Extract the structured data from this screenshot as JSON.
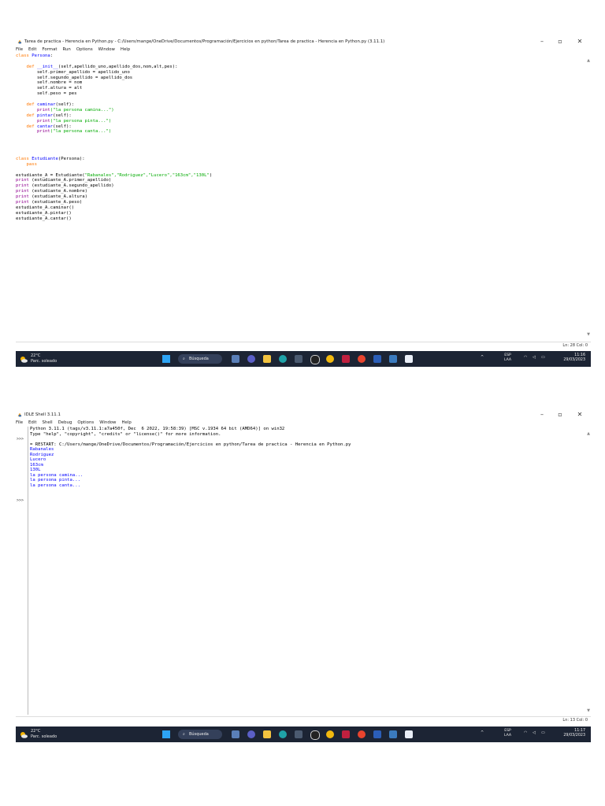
{
  "editor_window": {
    "title": "Tarea de practica - Herencia en Python.py - C:/Users/mange/OneDrive/Documentos/Programación/Ejercicios en python/Tarea de practica - Herencia en Python.py (3.11.1)",
    "menu": [
      "File",
      "Edit",
      "Format",
      "Run",
      "Options",
      "Window",
      "Help"
    ],
    "controls": {
      "minimize": "–",
      "maximize": "▫",
      "close": "✕"
    },
    "status": "Ln: 28   Col: 0"
  },
  "code": {
    "l1_kw": "class ",
    "l1_name": "Persona",
    "l1_rest": ":",
    "l3_kw": "    def ",
    "l3_name": "__init__",
    "l3_rest": "(self,apellido_uno,apellido_dos,nom,alt,pes):",
    "l4": "        self.primer_apellido = apellido_uno",
    "l5": "        self.segundo_apellido = apellido_dos",
    "l6": "        self.nombre = nom",
    "l7": "        self.altura = alt",
    "l8": "        self.peso = pes",
    "l10_kw": "    def ",
    "l10_name": "caminar",
    "l10_rest": "(self):",
    "l11_bi": "        print",
    "l11_str": "(\"la persona camina...\")",
    "l12_kw": "    def ",
    "l12_name": "pintar",
    "l12_rest": "(self):",
    "l13_bi": "        print",
    "l13_str": "(\"la persona pinta...\")",
    "l14_kw": "    def ",
    "l14_name": "cantar",
    "l14_rest": "(self):",
    "l15_bi": "        print",
    "l15_str": "(\"la persona canta...\")",
    "l20_kw": "class ",
    "l20_name": "Estudiante",
    "l20_rest": "(Persona):",
    "l21_kw": "    pass",
    "l23_pre": "estudiante_A = Estudiante(",
    "l23_str": "\"Rabanales\",\"Rodriguez\",\"Lucero\",\"163cm\",\"130L\"",
    "l23_post": ")",
    "l24_bi": "print",
    "l24_rest": " (estudiante_A.primer_apellido)",
    "l25_bi": "print",
    "l25_rest": " (estudiante_A.segundo_apellido)",
    "l26_bi": "print",
    "l26_rest": " (estudiante_A.nombre)",
    "l27_bi": "print",
    "l27_rest": " (estudiante_A.altura)",
    "l28_bi": "print",
    "l28_rest": " (estudiante_A.peso)",
    "l29": "estudiante_A.caminar()",
    "l30": "estudiante_A.pintar()",
    "l31": "estudiante_A.cantar()"
  },
  "shell_window": {
    "title": "IDLE Shell 3.11.1",
    "menu": [
      "File",
      "Edit",
      "Shell",
      "Debug",
      "Options",
      "Window",
      "Help"
    ],
    "controls": {
      "minimize": "–",
      "maximize": "▫",
      "close": "✕"
    },
    "prompt": ">>>",
    "status": "Ln: 13   Col: 0",
    "lines": {
      "banner1": "Python 3.11.1 (tags/v3.11.1:a7a450f, Dec  6 2022, 19:58:39) [MSC v.1934 64 bit (AMD64)] on win32",
      "banner2": "Type \"help\", \"copyright\", \"credits\" or \"license()\" for more information.",
      "restart": "= RESTART: C:/Users/mange/OneDrive/Documentos/Programación/Ejercicios en python/Tarea de practica - Herencia en Python.py",
      "out1": "Rabanales",
      "out2": "Rodriguez",
      "out3": "Lucero",
      "out4": "163cm",
      "out5": "130L",
      "out6": "la persona camina...",
      "out7": "la persona pinta...",
      "out8": "la persona canta..."
    }
  },
  "taskbar_top": {
    "weather_temp": "22°C",
    "weather_desc": "Parc. soleado",
    "search_label": "Búsqueda",
    "tray_chevron": "^",
    "lang1": "ESP",
    "lang2": "LAA",
    "time": "11:16",
    "date": "29/03/2023"
  },
  "taskbar_bottom": {
    "weather_temp": "22°C",
    "weather_desc": "Parc. soleado",
    "search_label": "Búsqueda",
    "tray_chevron": "^",
    "lang1": "ESP",
    "lang2": "LAA",
    "time": "11:17",
    "date": "29/03/2023"
  },
  "taskbar_apps": [
    "file-explorer",
    "teams",
    "folder",
    "edge",
    "calculator",
    "obs",
    "chrome",
    "mcafee",
    "opera",
    "word",
    "python",
    "idle"
  ],
  "colors": {
    "keyword": "#ff7700",
    "definition": "#0000ff",
    "string": "#00aa00",
    "builtin": "#900090",
    "taskbar": "#1c2434",
    "shell_output": "#0000ff"
  }
}
